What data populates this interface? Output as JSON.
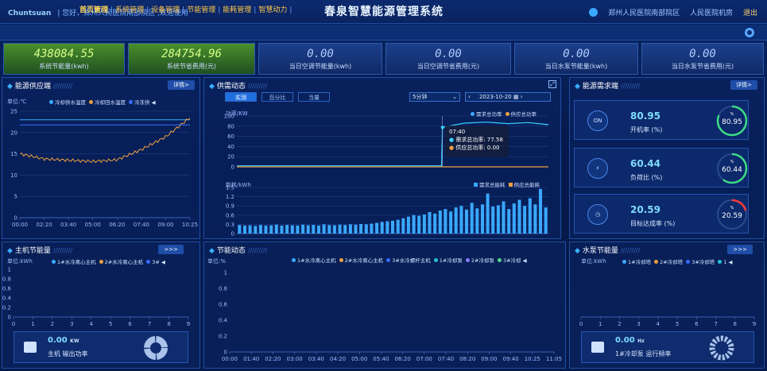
{
  "header": {
    "brand": "Chuntsuan",
    "greeting": "| 您好，郑州人民医院南部院区 ,欢迎使用",
    "title": "春泉智慧能源管理系统",
    "site": "郑州人民医院南部院区",
    "room": "人民医院机房",
    "logout": "退出"
  },
  "nav": {
    "items": [
      "首页管理",
      "系统管理",
      "设备管理",
      "节能管理",
      "能耗管理",
      "智慧动力"
    ],
    "active": 0
  },
  "kpis": [
    {
      "value": "438084.55",
      "label": "系统节能量(kwh)",
      "color": "green"
    },
    {
      "value": "284754.96",
      "label": "系统节省费用(元)",
      "color": "green"
    },
    {
      "value": "0.00",
      "label": "当日空调节能量(kwh)",
      "color": "blue"
    },
    {
      "value": "0.00",
      "label": "当日空调节省费用(元)",
      "color": "blue"
    },
    {
      "value": "0.00",
      "label": "当日水泵节能量(kwh)",
      "color": "blue"
    },
    {
      "value": "0.00",
      "label": "当日水泵节省费用(元)",
      "color": "blue"
    }
  ],
  "energy_supply": {
    "title": "能源供应端",
    "slashes": "/////////",
    "more": "详情>",
    "unit": "单位:℃",
    "legend": [
      "冷却供水温度",
      "冷却回水温度",
      "冷冻供"
    ],
    "legend_colors": [
      "#3aa8ff",
      "#f0a040",
      "#3a6cff"
    ],
    "y_ticks": [
      "25",
      "20",
      "15",
      "10",
      "5",
      "0"
    ],
    "x_ticks": [
      "00:00",
      "02:20",
      "03:40",
      "05:00",
      "06:20",
      "07:40",
      "09:00",
      "10:25"
    ]
  },
  "supply_dynamic": {
    "title": "供需动态",
    "slashes": "/////////",
    "tabs": [
      "实测",
      "百分比",
      "当量"
    ],
    "interval": "5分钟",
    "date": "2023-10-20",
    "unit_top": "功率/KW",
    "legend_top": [
      "需求总功率",
      "供应总功率"
    ],
    "y_top": [
      "100",
      "80",
      "60",
      "40",
      "20",
      "0"
    ],
    "tooltip": {
      "time": "07:40",
      "line1": "需求总功率: 77.58",
      "line2": "供应总功率: 0.00"
    },
    "unit_bottom": "能耗/kWh",
    "legend_bottom": [
      "需求总能耗",
      "供应总能耗"
    ],
    "y_bottom": [
      "1.5",
      "1.2",
      "0.9",
      "0.6",
      "0.3",
      "0"
    ]
  },
  "energy_demand": {
    "title": "能源需求端",
    "slashes": "/////////",
    "more": "详情>",
    "stats": [
      {
        "icon": "ON",
        "value": "80.95",
        "label": "开机率 (%)",
        "ring": 80.95,
        "color": "#3ddc84"
      },
      {
        "icon": "⚡",
        "value": "60.44",
        "label": "负荷比 (%)",
        "ring": 60.44,
        "color": "#3ddc84"
      },
      {
        "icon": "◷",
        "value": "20.59",
        "label": "目标达成率 (%)",
        "ring": 20.59,
        "color": "#ff3b3b"
      }
    ]
  },
  "host_saving": {
    "title": "主机节能量",
    "slashes": "/////////",
    "more": ">>>",
    "unit": "单位:kWh",
    "legend": [
      "1#水冷离心主机",
      "2#水冷离心主机",
      "3#"
    ],
    "y_ticks": [
      "1",
      "0.8",
      "0.6",
      "0.4",
      "0.2",
      "0"
    ],
    "x_ticks": [
      "0",
      "1",
      "2",
      "3",
      "4",
      "5",
      "6",
      "7",
      "8",
      "9"
    ],
    "power_value": "0.00",
    "power_unit": "KW",
    "power_label": "主机 输出功率"
  },
  "saving_dynamic": {
    "title": "节能动态",
    "slashes": "/////////",
    "unit": "单位:%",
    "legend": [
      "1#水冷离心主机",
      "2#水冷离心主机",
      "3#水冷螺杆主机",
      "1#冷却泵",
      "2#冷却泵",
      "3#冷却"
    ],
    "y_ticks": [
      "1",
      "0.8",
      "0.6",
      "0.4",
      "0.2",
      "0"
    ],
    "x_ticks": [
      "00:00",
      "01:40",
      "02:20",
      "03:00",
      "03:40",
      "04:20",
      "05:00",
      "05:40",
      "06:20",
      "07:00",
      "07:40",
      "08:20",
      "09:00",
      "09:40",
      "10:25",
      "11:05"
    ]
  },
  "pump_saving": {
    "title": "水泵节能量",
    "slashes": "/////////",
    "more": ">>>",
    "unit": "单位:kWh",
    "legend": [
      "1#冷却塔",
      "2#冷却塔",
      "3#冷却塔",
      "1"
    ],
    "x_ticks": [
      "0",
      "1",
      "2",
      "3",
      "4",
      "5",
      "6",
      "7",
      "8",
      "9"
    ],
    "freq_value": "0.00",
    "freq_unit": "Hz",
    "freq_label": "1#冷却泵 运行频率"
  },
  "chart_data": [
    {
      "type": "line",
      "title": "能源供应端",
      "ylabel": "单位:℃",
      "ylim": [
        0,
        25
      ],
      "x": [
        "00:00",
        "02:20",
        "03:40",
        "05:00",
        "06:20",
        "07:40",
        "09:00",
        "10:25"
      ],
      "series": [
        {
          "name": "冷却供水温度",
          "values": [
            23.0,
            23.0,
            23.0,
            23.0,
            23.0,
            23.0,
            23.0,
            23.0
          ]
        },
        {
          "name": "冷却回水温度",
          "values": [
            15.0,
            13.8,
            13.5,
            13.2,
            13.6,
            16.0,
            19.0,
            23.5
          ]
        },
        {
          "name": "冷冻供",
          "values": [
            21.8,
            21.8,
            21.8,
            21.8,
            21.8,
            21.8,
            21.8,
            21.8
          ]
        }
      ]
    },
    {
      "type": "line",
      "ylabel": "功率/KW",
      "ylim": [
        0,
        100
      ],
      "x": [
        "00:00",
        "01:40",
        "03:20",
        "05:00",
        "06:40",
        "07:35",
        "07:40",
        "08:20",
        "09:00",
        "09:40",
        "10:25",
        "11:05"
      ],
      "series": [
        {
          "name": "需求总功率",
          "values": [
            2,
            2,
            2,
            2,
            2,
            2,
            77.58,
            86,
            88,
            85,
            87,
            83
          ]
        },
        {
          "name": "供应总功率",
          "values": [
            0,
            0,
            0,
            0,
            0,
            0,
            0,
            0,
            0,
            0,
            0,
            0
          ]
        }
      ]
    },
    {
      "type": "bar",
      "ylabel": "能耗/kWh",
      "ylim": [
        0,
        1.5
      ],
      "series": [
        {
          "name": "需求总能耗",
          "values": [
            0.28,
            0.26,
            0.27,
            0.25,
            0.28,
            0.26,
            0.27,
            0.29,
            0.26,
            0.28,
            0.27,
            0.26,
            0.29,
            0.27,
            0.28,
            0.26,
            0.3,
            0.28,
            0.27,
            0.29,
            0.28,
            0.3,
            0.29,
            0.31,
            0.3,
            0.32,
            0.35,
            0.38,
            0.4,
            0.42,
            0.45,
            0.5,
            0.55,
            0.6,
            0.58,
            0.62,
            0.7,
            0.65,
            0.75,
            0.8,
            0.72,
            0.85,
            0.9,
            0.78,
            1.0,
            0.82,
            0.95,
            1.3,
            0.88,
            0.92,
            1.05,
            0.8,
            0.98,
            1.1,
            0.9,
            1.15,
            0.95,
            1.45,
            0.85
          ]
        },
        {
          "name": "供应总能耗",
          "values": []
        }
      ]
    },
    {
      "type": "line",
      "title": "主机节能量",
      "ylabel": "单位:kWh",
      "ylim": [
        0,
        1
      ],
      "x": [
        "0",
        "1",
        "2",
        "3",
        "4",
        "5",
        "6",
        "7",
        "8",
        "9"
      ],
      "series": []
    },
    {
      "type": "line",
      "title": "节能动态",
      "ylabel": "单位:%",
      "ylim": [
        0,
        1
      ],
      "x": [
        "00:00",
        "01:40",
        "02:20",
        "03:00",
        "03:40",
        "04:20",
        "05:00",
        "05:40",
        "06:20",
        "07:00",
        "07:40",
        "08:20",
        "09:00",
        "09:40",
        "10:25",
        "11:05"
      ],
      "series": []
    },
    {
      "type": "line",
      "title": "水泵节能量",
      "ylabel": "单位:kWh",
      "x": [
        "0",
        "1",
        "2",
        "3",
        "4",
        "5",
        "6",
        "7",
        "8",
        "9"
      ],
      "series": []
    }
  ]
}
